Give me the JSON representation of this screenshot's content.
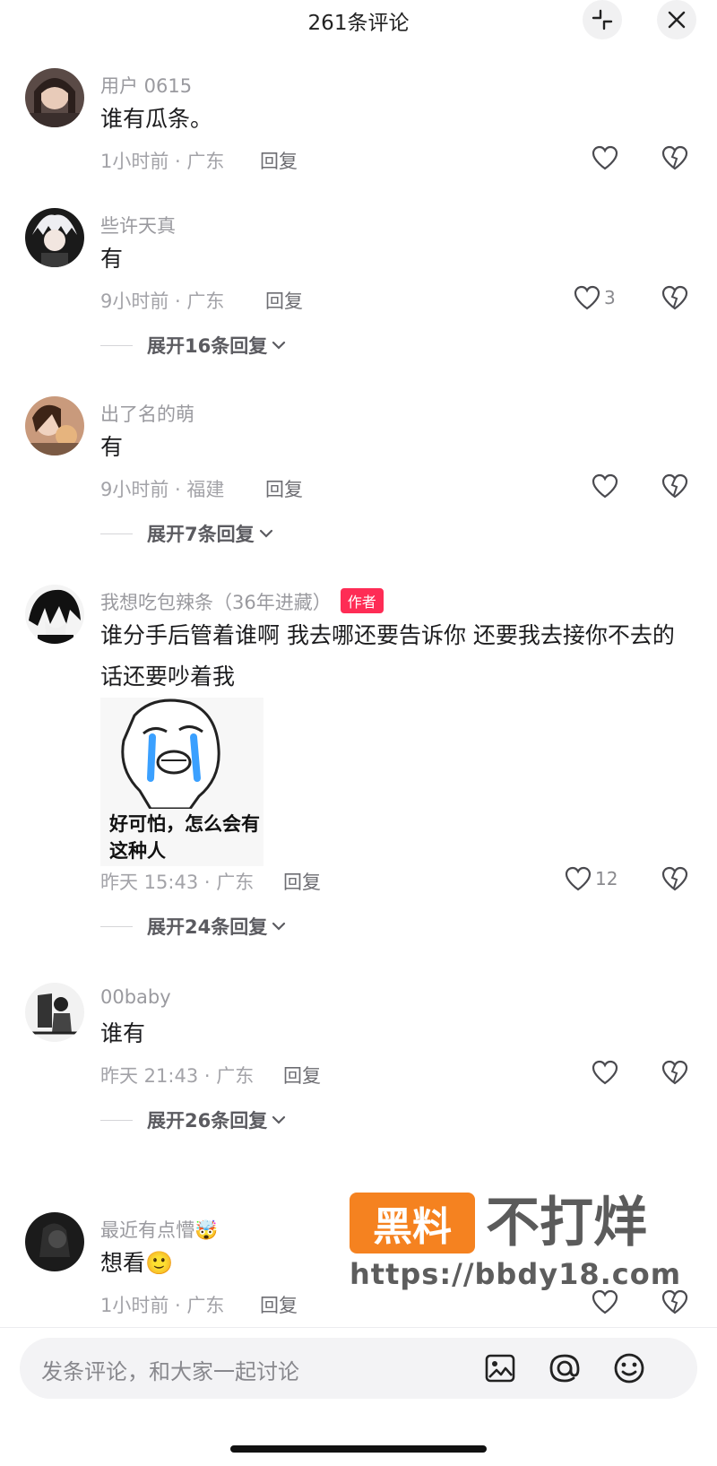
{
  "header": {
    "title": "261条评论"
  },
  "comments": [
    {
      "user": "用户 0615",
      "text": "谁有瓜条。",
      "time_loc": "1小时前 · 广东",
      "reply": "回复",
      "likes": ""
    },
    {
      "user": "些许天真",
      "text": "有",
      "time_loc": "9小时前 · 广东",
      "reply": "回复",
      "likes": "3",
      "expand": "展开16条回复"
    },
    {
      "user": "出了名的萌",
      "text": "有",
      "time_loc": "9小时前 · 福建",
      "reply": "回复",
      "likes": "",
      "expand": "展开7条回复"
    },
    {
      "user": "我想吃包辣条（36年进藏）",
      "badge": "作者",
      "text": "谁分手后管着谁啊 我去哪还要告诉你 还要我去接你不去的话还要吵着我",
      "sticker_caption": "好可怕，怎么会有这种人",
      "time_loc": "昨天 15:43 · 广东",
      "reply": "回复",
      "likes": "12",
      "expand": "展开24条回复"
    },
    {
      "user": "00baby",
      "text": "谁有",
      "time_loc": "昨天 21:43 · 广东",
      "reply": "回复",
      "likes": "",
      "expand": "展开26条回复"
    },
    {
      "user": "最近有点懵🤯",
      "text": "想看🙂",
      "time_loc": "1小时前 · 广东",
      "reply": "回复",
      "likes": ""
    }
  ],
  "watermark": {
    "box": "黑料",
    "text": "不打烊",
    "url": "https://bbdy18.com"
  },
  "input": {
    "placeholder": "发条评论，和大家一起讨论"
  },
  "icons": [
    "collapse-icon",
    "close-icon",
    "heart-icon",
    "heart-broken-icon",
    "chevron-down-icon",
    "image-icon",
    "at-icon",
    "emoji-icon"
  ]
}
